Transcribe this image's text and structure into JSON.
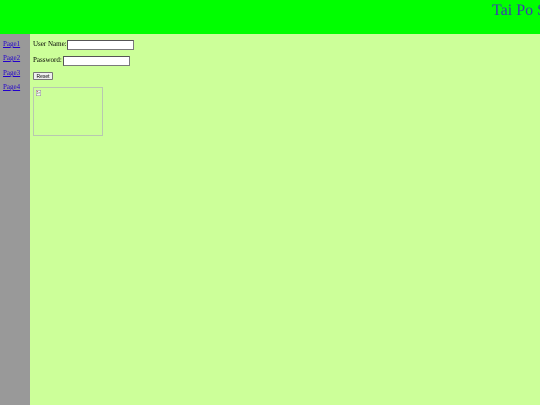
{
  "header": {
    "title": "Tai Po S",
    "background": "#00ff00"
  },
  "sidebar": {
    "background": "#999999",
    "links": [
      {
        "label": "Page1"
      },
      {
        "label": "Page2"
      },
      {
        "label": "Page3"
      },
      {
        "label": "Page4"
      }
    ]
  },
  "main": {
    "background": "#ccff99",
    "form": {
      "username_label": "User Name:",
      "username_value": "",
      "password_label": "Password:",
      "password_value": "",
      "reset_label": "Reset"
    },
    "image": {
      "icon": "broken-image-icon"
    }
  }
}
